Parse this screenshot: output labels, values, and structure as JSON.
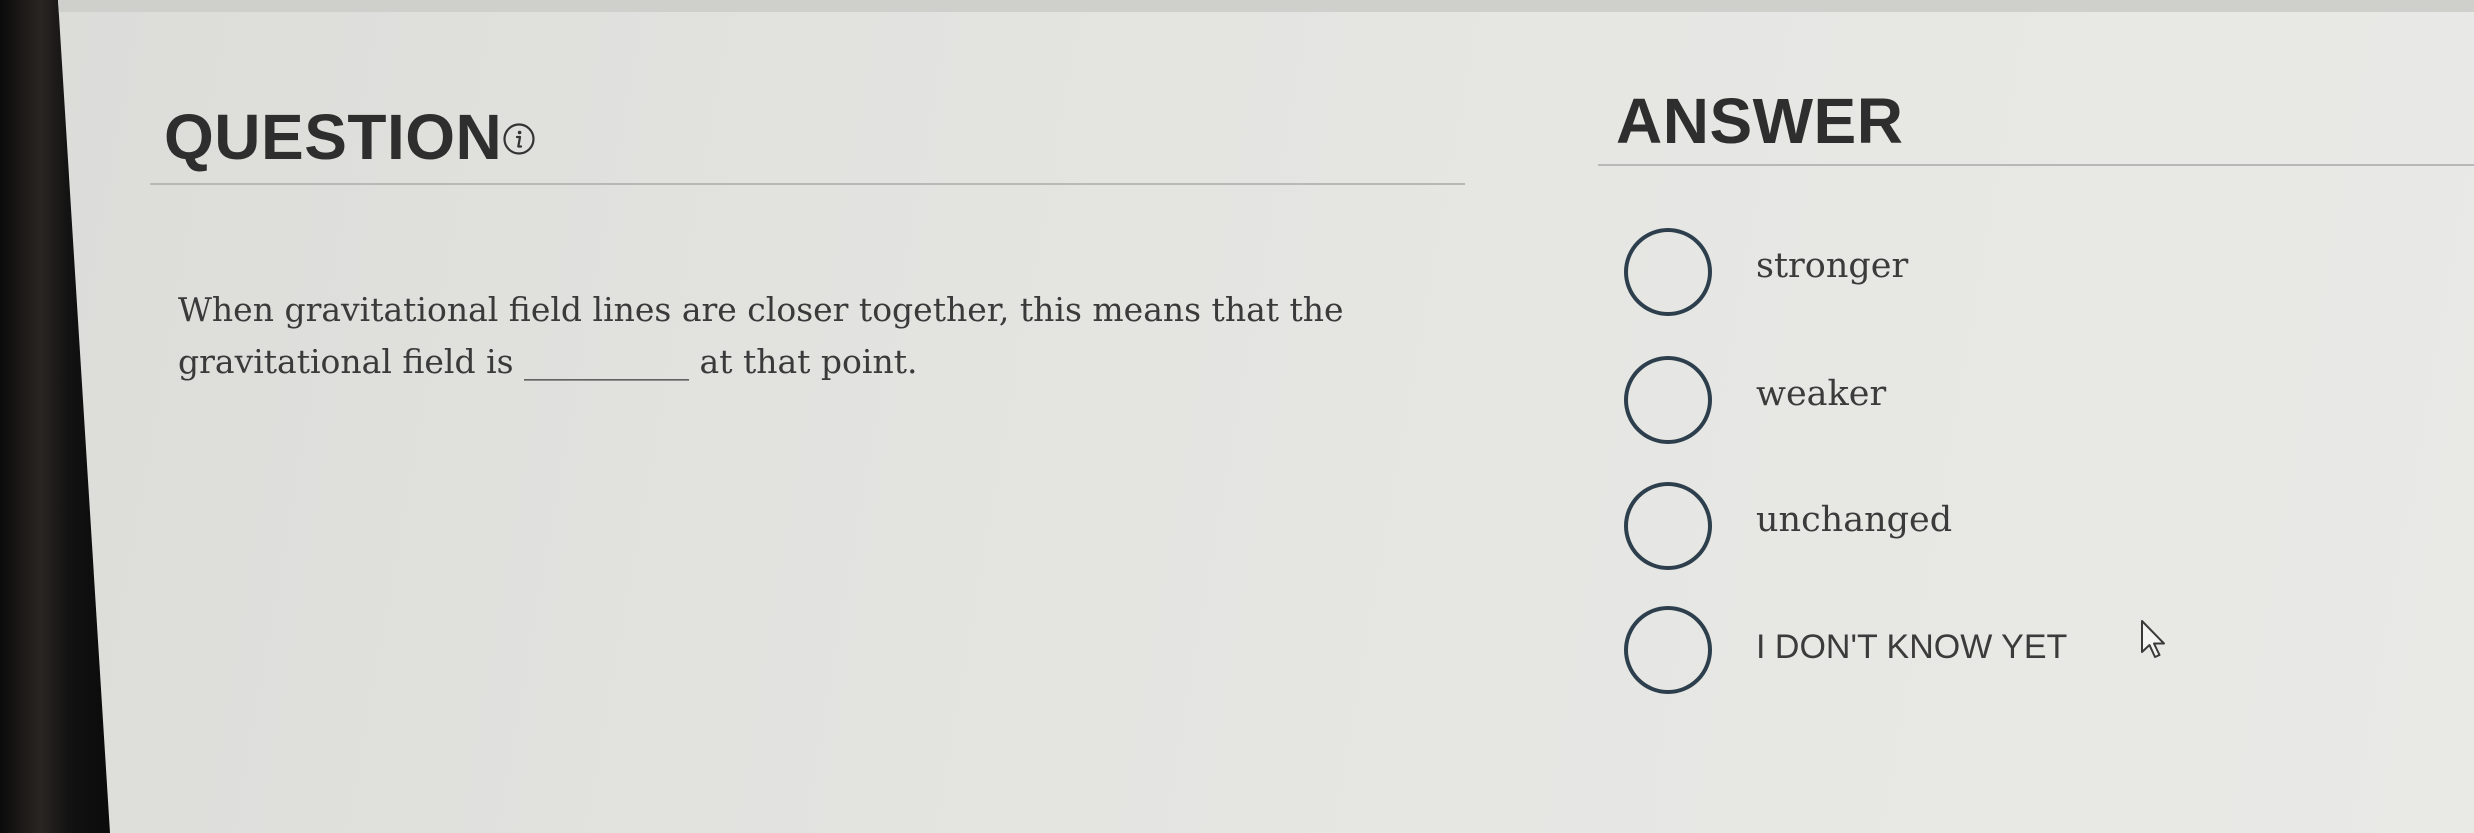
{
  "question": {
    "heading": "QUESTION",
    "info_icon": "info-circle-icon",
    "text": "When gravitational field lines are closer together, this means that the gravitational field is __________ at that point."
  },
  "answer": {
    "heading": "ANSWER",
    "options": [
      {
        "label": "stronger",
        "selected": false
      },
      {
        "label": "weaker",
        "selected": false
      },
      {
        "label": "unchanged",
        "selected": false
      },
      {
        "label": "I DON'T KNOW YET",
        "selected": false
      }
    ]
  },
  "colors": {
    "radio_border": "#2d3e4c",
    "text": "#3a3a3a",
    "heading": "#2e2e2e",
    "background": "#e4e4e1"
  },
  "cursor_icon": "mouse-pointer-icon"
}
